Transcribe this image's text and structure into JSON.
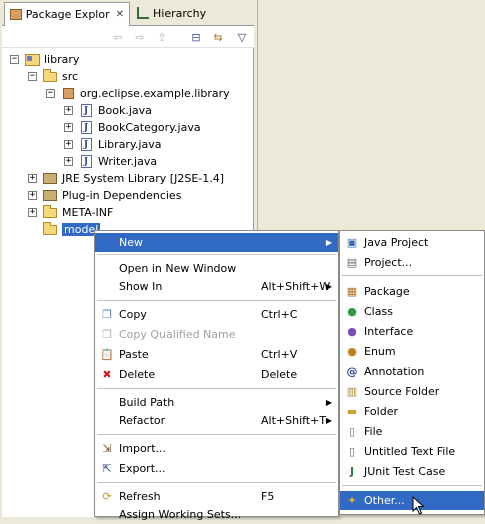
{
  "tabs": [
    {
      "label": "Package Explor"
    },
    {
      "label": "Hierarchy"
    }
  ],
  "tree": [
    {
      "label": "library",
      "level": 0,
      "expanded": true
    },
    {
      "label": "src",
      "level": 1,
      "expanded": true
    },
    {
      "label": "org.eclipse.example.library",
      "level": 2,
      "expanded": true
    },
    {
      "label": "Book.java",
      "level": 3,
      "expanded": false
    },
    {
      "label": "BookCategory.java",
      "level": 3,
      "expanded": false
    },
    {
      "label": "Library.java",
      "level": 3,
      "expanded": false
    },
    {
      "label": "Writer.java",
      "level": 3,
      "expanded": false
    },
    {
      "label": "JRE System Library [J2SE-1.4]",
      "level": 1,
      "expanded": false
    },
    {
      "label": "Plug-in Dependencies",
      "level": 1,
      "expanded": false
    },
    {
      "label": "META-INF",
      "level": 1,
      "expanded": false
    },
    {
      "label": "model",
      "level": 1,
      "selected": true
    }
  ],
  "context_menu": {
    "items": [
      {
        "label": "New",
        "shortcut": "",
        "highlighted": true,
        "submenu": true
      },
      {
        "label": "Open in New Window",
        "shortcut": ""
      },
      {
        "label": "Show In",
        "shortcut": "Alt+Shift+W",
        "submenu": true
      },
      {
        "label": "Copy",
        "shortcut": "Ctrl+C"
      },
      {
        "label": "Copy Qualified Name",
        "shortcut": "",
        "disabled": true
      },
      {
        "label": "Paste",
        "shortcut": "Ctrl+V"
      },
      {
        "label": "Delete",
        "shortcut": "Delete"
      },
      {
        "label": "Build Path",
        "shortcut": "",
        "submenu": true
      },
      {
        "label": "Refactor",
        "shortcut": "Alt+Shift+T",
        "submenu": true
      },
      {
        "label": "Import...",
        "shortcut": ""
      },
      {
        "label": "Export...",
        "shortcut": ""
      },
      {
        "label": "Refresh",
        "shortcut": "F5"
      },
      {
        "label": "Assign Working Sets...",
        "shortcut": ""
      }
    ]
  },
  "new_submenu": {
    "items": [
      {
        "label": "Java Project"
      },
      {
        "label": "Project..."
      },
      {
        "label": "Package"
      },
      {
        "label": "Class"
      },
      {
        "label": "Interface"
      },
      {
        "label": "Enum"
      },
      {
        "label": "Annotation"
      },
      {
        "label": "Source Folder"
      },
      {
        "label": "Folder"
      },
      {
        "label": "File"
      },
      {
        "label": "Untitled Text File"
      },
      {
        "label": "JUnit Test Case"
      },
      {
        "label": "Other...",
        "highlighted": true
      }
    ]
  },
  "colors": {
    "selection": "#316ac5",
    "menu_bg": "#ffffff",
    "chrome": "#ece9d8"
  }
}
